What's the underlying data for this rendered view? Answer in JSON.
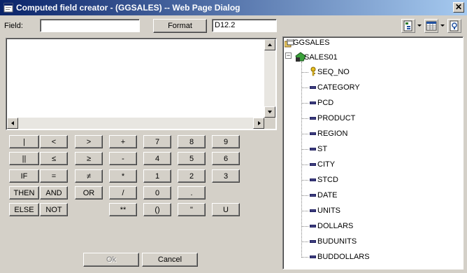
{
  "window": {
    "title": "Computed field creator - (GGSALES) -- Web Page Dialog"
  },
  "form": {
    "field_label": "Field:",
    "field_value": "",
    "format_button": "Format",
    "format_value": "D12.2"
  },
  "toolbar": {
    "icons": [
      "field-list-icon",
      "table-icon",
      "help-icon"
    ]
  },
  "calculator": {
    "rows": [
      [
        "|",
        "<",
        ">",
        "+",
        "7",
        "8",
        "9"
      ],
      [
        "||",
        "≤",
        "≥",
        "-",
        "4",
        "5",
        "6"
      ],
      [
        "IF",
        "=",
        "≠",
        "*",
        "1",
        "2",
        "3"
      ],
      [
        "THEN",
        "AND",
        "OR",
        "/",
        "0",
        "."
      ],
      [
        "ELSE",
        "NOT",
        "**",
        "()",
        "\"",
        "U"
      ]
    ]
  },
  "actions": {
    "ok": "Ok",
    "cancel": "Cancel"
  },
  "tree": {
    "root": "GGSALES",
    "segment": "SALES01",
    "fields": [
      "SEQ_NO",
      "CATEGORY",
      "PCD",
      "PRODUCT",
      "REGION",
      "ST",
      "CITY",
      "STCD",
      "DATE",
      "UNITS",
      "DOLLARS",
      "BUDUNITS",
      "BUDDOLLARS"
    ]
  }
}
